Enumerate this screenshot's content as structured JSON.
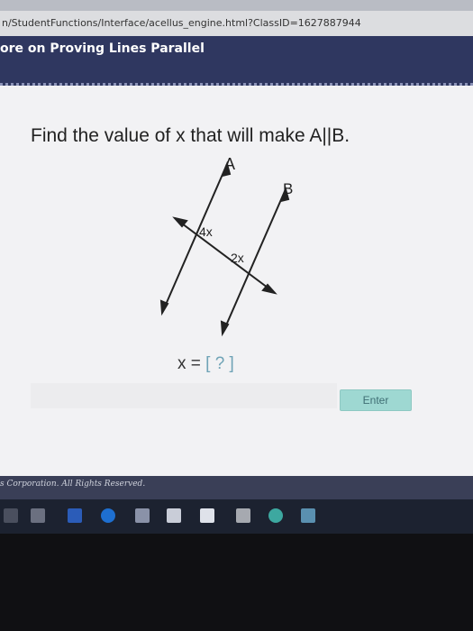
{
  "browser": {
    "url": "n/StudentFunctions/Interface/acellus_engine.html?ClassID=1627887944"
  },
  "header": {
    "title": "ore on Proving Lines Parallel"
  },
  "question": {
    "text": "Find the value of x that will make A||B."
  },
  "diagram": {
    "line_a_label": "A",
    "line_b_label": "B",
    "angle_1_label": "4x",
    "angle_2_label": "2x"
  },
  "answer": {
    "prefix": "x = ",
    "placeholder": "[ ? ]"
  },
  "buttons": {
    "enter": "Enter"
  },
  "footer": {
    "copyright": "s Corporation. All Rights Reserved."
  },
  "taskbar": {
    "icons": [
      "power-icon",
      "task-view-icon",
      "word-icon",
      "edge-icon",
      "file-explorer-icon",
      "store-icon",
      "mail-icon",
      "calculator-icon",
      "chrome-icon",
      "app-icon"
    ]
  }
}
